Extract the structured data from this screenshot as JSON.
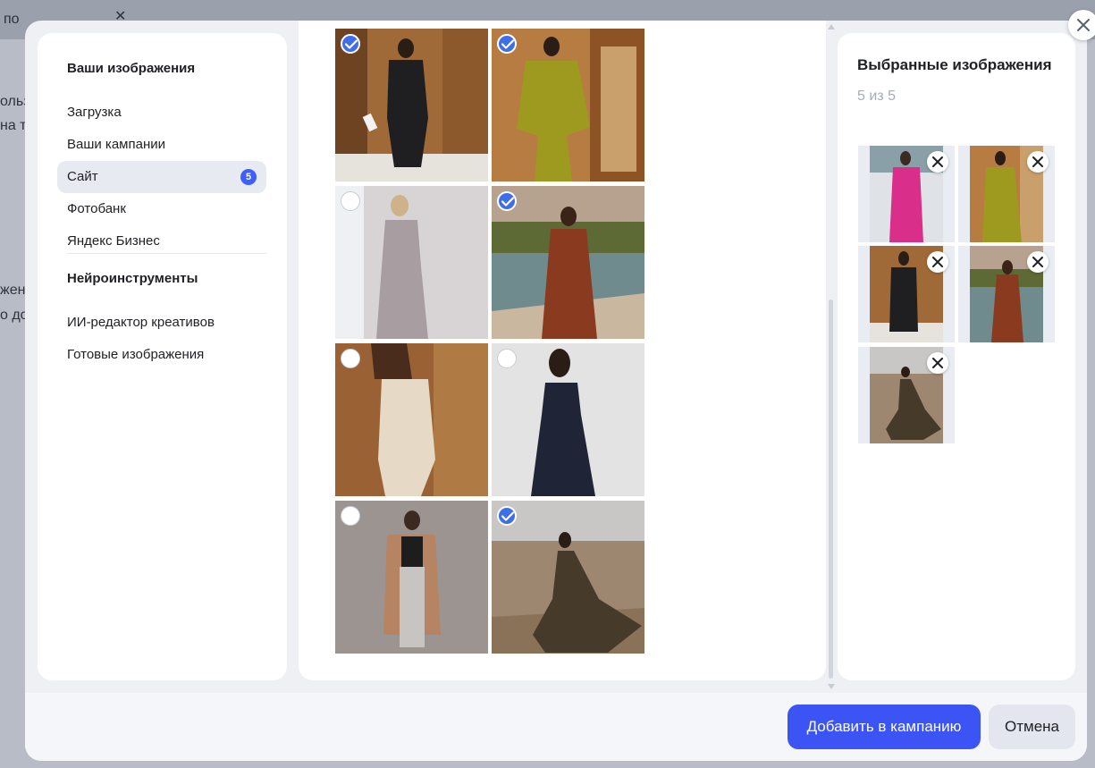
{
  "background": {
    "top_text": "по",
    "side_fragments": [
      "ользо",
      "на т",
      "жен",
      "о до"
    ]
  },
  "sidebar": {
    "section1_title": "Ваши изображения",
    "items": [
      {
        "label": "Загрузка"
      },
      {
        "label": "Ваши кампании"
      },
      {
        "label": "Сайт",
        "badge": "5",
        "active": true
      },
      {
        "label": "Фотобанк"
      },
      {
        "label": "Яндекс Бизнес"
      }
    ],
    "section2_title": "Нейроинструменты",
    "items2": [
      {
        "label": "ИИ-редактор креативов"
      },
      {
        "label": "Готовые изображения"
      }
    ]
  },
  "gallery": {
    "images": [
      {
        "name": "black-linen-suit",
        "selected": true
      },
      {
        "name": "olive-kimono-jacket",
        "selected": true
      },
      {
        "name": "grey-vest-trousers",
        "selected": false
      },
      {
        "name": "rust-set-by-lake",
        "selected": true
      },
      {
        "name": "white-halter-top",
        "selected": false
      },
      {
        "name": "navy-slip-dress",
        "selected": false
      },
      {
        "name": "camel-coat-grey-trousers",
        "selected": false
      },
      {
        "name": "brown-cape-desert",
        "selected": true
      }
    ]
  },
  "selected_panel": {
    "title": "Выбранные изображения",
    "count_text": "5 из 5",
    "items": [
      {
        "name": "pink-suit"
      },
      {
        "name": "olive-kimono-jacket"
      },
      {
        "name": "black-linen-suit"
      },
      {
        "name": "rust-set-by-lake"
      },
      {
        "name": "brown-cape-desert"
      }
    ]
  },
  "footer": {
    "add_label": "Добавить в кампанию",
    "cancel_label": "Отмена"
  },
  "colors": {
    "accent": "#3d54f4",
    "check": "#3f6ee8",
    "panel": "#ffffff",
    "modal_bg": "#eef0f4"
  },
  "icons": [
    "check-icon",
    "close-icon",
    "remove-icon"
  ]
}
